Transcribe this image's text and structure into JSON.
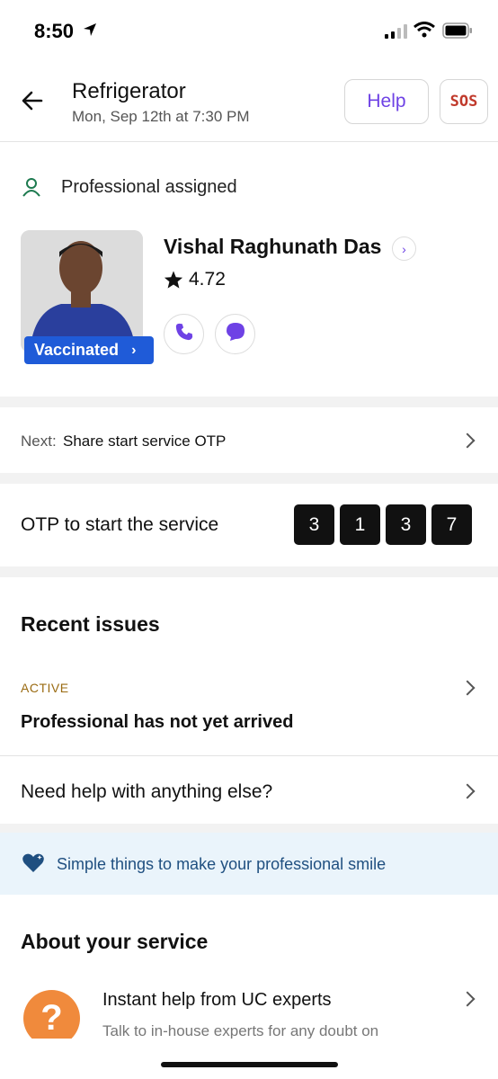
{
  "status_bar": {
    "time": "8:50"
  },
  "header": {
    "title": "Refrigerator",
    "subtitle": "Mon, Sep 12th at 7:30 PM",
    "help_label": "Help",
    "sos_label": "SOS"
  },
  "professional": {
    "status": "Professional assigned",
    "name": "Vishal Raghunath Das",
    "rating": "4.72",
    "badge": "Vaccinated"
  },
  "next_step": {
    "label": "Next:",
    "value": "Share start service OTP"
  },
  "otp": {
    "label": "OTP to start the service",
    "digits": [
      "3",
      "1",
      "3",
      "7"
    ]
  },
  "recent_issues": {
    "title": "Recent issues",
    "items": [
      {
        "status": "ACTIVE",
        "text": "Professional has not yet arrived"
      }
    ],
    "help_else": "Need help with anything else?"
  },
  "banner": {
    "text": "Simple things to make your professional smile"
  },
  "about": {
    "title": "About your service",
    "items": [
      {
        "title": "Instant help from UC experts",
        "subtitle": "Talk to in-house experts for any doubt on"
      }
    ]
  },
  "colors": {
    "accent": "#6e42e5",
    "sos": "#c0392b",
    "badge": "#1f5bd8",
    "active": "#9a6b12",
    "banner_bg": "#eaf4fb",
    "banner_text": "#1f4f80",
    "uc_orange": "#f08a3c"
  },
  "icons": {
    "back": "arrow-left-icon",
    "person": "person-icon",
    "call": "phone-icon",
    "chat": "chat-icon",
    "heart": "heart-icon",
    "question": "question-icon"
  }
}
